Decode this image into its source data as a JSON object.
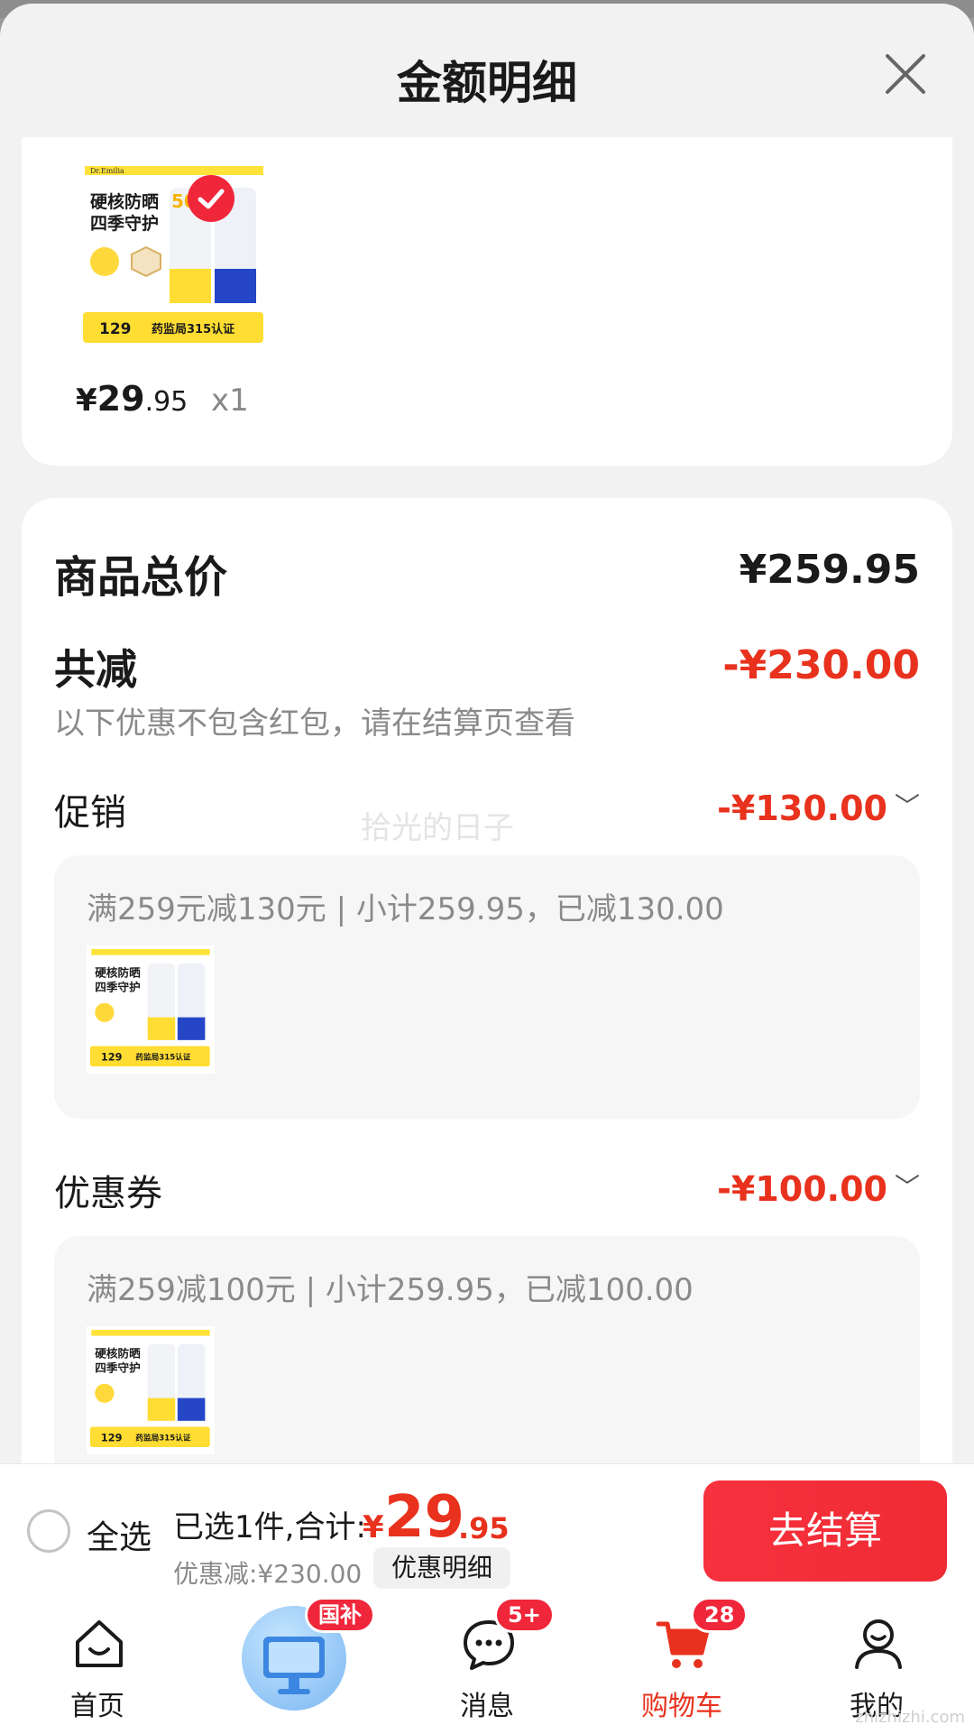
{
  "sheet": {
    "title": "金额明细",
    "close_icon": "close-icon"
  },
  "product": {
    "thumb_icon": "sunscreen-product-image",
    "thumb_text": {
      "headline_1": "硬核防晒",
      "headline_2": "四季守护",
      "brand": "Dr.Emilia",
      "price_tag": "129",
      "cert_tag": "药监局315认证",
      "spf": "50"
    },
    "price_yuan_sign": "¥",
    "price_int": "29",
    "price_dec": ".95",
    "qty": "x1"
  },
  "summary": {
    "total_label": "商品总价",
    "total_value": "¥259.95",
    "reduce_label": "共减",
    "reduce_value": "-¥230.00",
    "reduce_note": "以下优惠不包含红包，请在结算页查看"
  },
  "promotion": {
    "label": "促销",
    "value": "-¥130.00",
    "detail": "满259元减130元 | 小计259.95，已减130.00"
  },
  "coupon": {
    "label": "优惠券",
    "value": "-¥100.00",
    "detail": "满259减100元 | 小计259.95，已减100.00"
  },
  "watermark": "拾光的日子",
  "checkout": {
    "select_all": "全选",
    "selected_summary": "已选1件,合计:",
    "currency": "¥",
    "total_int": "29",
    "total_dec": ".95",
    "discount_text": "优惠减:¥230.00",
    "detail_chip": "优惠明细",
    "checkout_button": "去结算"
  },
  "tabbar": {
    "items": [
      {
        "label": "首页",
        "icon": "home-icon"
      },
      {
        "label": "",
        "icon": "subsidy-promo-icon",
        "badge": "国补"
      },
      {
        "label": "消息",
        "icon": "message-icon",
        "badge": "5+"
      },
      {
        "label": "购物车",
        "icon": "cart-icon",
        "badge": "28",
        "active": true
      },
      {
        "label": "我的",
        "icon": "profile-icon"
      }
    ]
  },
  "site_watermark": "zhizhizhi.com",
  "colors": {
    "accent": "#e8321e",
    "button": "#f7313e",
    "badge": "#f0263a",
    "sheet_bg": "#f2f2f2"
  }
}
